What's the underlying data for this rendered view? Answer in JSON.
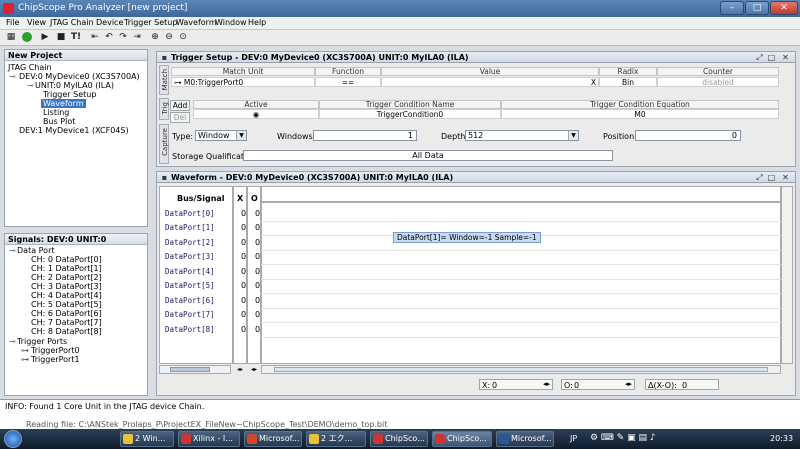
{
  "window": {
    "title": "ChipScope Pro Analyzer [new project]"
  },
  "menu": [
    "File",
    "View",
    "JTAG Chain",
    "Device",
    "Trigger Setup",
    "Waveform",
    "Window",
    "Help"
  ],
  "toolbar": {
    "trigger_now_label": "T!"
  },
  "project_pane": {
    "title": "New Project",
    "items": [
      "JTAG Chain",
      "DEV:0 MyDevice0 (XC3S700A)",
      "UNIT:0 MyILA0 (ILA)",
      "Trigger Setup",
      "Waveform",
      "Listing",
      "Bus Plot",
      "DEV:1 MyDevice1 (XCF04S)"
    ]
  },
  "signals_pane": {
    "title": "Signals: DEV:0 UNIT:0",
    "data_port": "Data Port",
    "channels": [
      "CH: 0 DataPort[0]",
      "CH: 1 DataPort[1]",
      "CH: 2 DataPort[2]",
      "CH: 3 DataPort[3]",
      "CH: 4 DataPort[4]",
      "CH: 5 DataPort[5]",
      "CH: 6 DataPort[6]",
      "CH: 7 DataPort[7]",
      "CH: 8 DataPort[8]"
    ],
    "trigger_ports": "Trigger Ports",
    "ports": [
      "TriggerPort0",
      "TriggerPort1"
    ]
  },
  "trigger_setup": {
    "title": "Trigger Setup - DEV:0 MyDevice0 (XC3S700A) UNIT:0 MyILA0 (ILA)",
    "tabs": {
      "match": "Match",
      "trig": "Trig",
      "capture": "Capture"
    },
    "match_headers": [
      "Match Unit",
      "Function",
      "Value",
      "Radix",
      "Counter"
    ],
    "match_row": {
      "unit": "M0:TriggerPort0",
      "function": "==",
      "value": "X",
      "radix": "Bin",
      "counter": "disabled"
    },
    "add_label": "Add",
    "del_label": "Del",
    "trig_headers": [
      "Active",
      "Trigger Condition Name",
      "Trigger Condition Equation"
    ],
    "trig_row": {
      "name": "TriggerCondition0",
      "equation": "M0"
    },
    "type_label": "Type:",
    "type_value": "Window",
    "windows_label": "Windows:",
    "windows_value": "1",
    "depth_label": "Depth:",
    "depth_value": "512",
    "position_label": "Position:",
    "position_value": "0",
    "storage_label": "Storage Qualification:",
    "storage_value": "All Data"
  },
  "waveform": {
    "title": "Waveform - DEV:0 MyDevice0 (XC3S700A) UNIT:0 MyILA0 (ILA)",
    "col_bus": "Bus/Signal",
    "col_x": "X",
    "col_o": "O",
    "signals": [
      {
        "name": "DataPort[0]",
        "x": "0",
        "o": "0"
      },
      {
        "name": "DataPort[1]",
        "x": "0",
        "o": "0"
      },
      {
        "name": "DataPort[2]",
        "x": "0",
        "o": "0"
      },
      {
        "name": "DataPort[3]",
        "x": "0",
        "o": "0"
      },
      {
        "name": "DataPort[4]",
        "x": "0",
        "o": "0"
      },
      {
        "name": "DataPort[5]",
        "x": "0",
        "o": "0"
      },
      {
        "name": "DataPort[6]",
        "x": "0",
        "o": "0"
      },
      {
        "name": "DataPort[7]",
        "x": "0",
        "o": "0"
      },
      {
        "name": "DataPort[8]",
        "x": "0",
        "o": "0"
      }
    ],
    "tooltip": "DataPort[1]= Window=-1 Sample=-1",
    "cursor_x_label": "X:",
    "cursor_x_value": "0",
    "cursor_o_label": "O:",
    "cursor_o_value": "0",
    "delta_label": "Δ(X-O):",
    "delta_value": "0"
  },
  "console": {
    "line1": "INFO: Found 1 Core Unit in the JTAG device Chain.",
    "line2": "Reading file: C:\\ANStek_Prolaps_P\\ProjectEX_FileNew~ChipScope_Test\\DEMO\\demo_top.bit"
  },
  "taskbar": {
    "tasks": [
      "2 Win...",
      "Xilinx - I...",
      "Microsof...",
      "2 エク...",
      "ChipSco...",
      "ChipSco...",
      "Microsof..."
    ],
    "lang": "JP",
    "clock": "20:33"
  }
}
